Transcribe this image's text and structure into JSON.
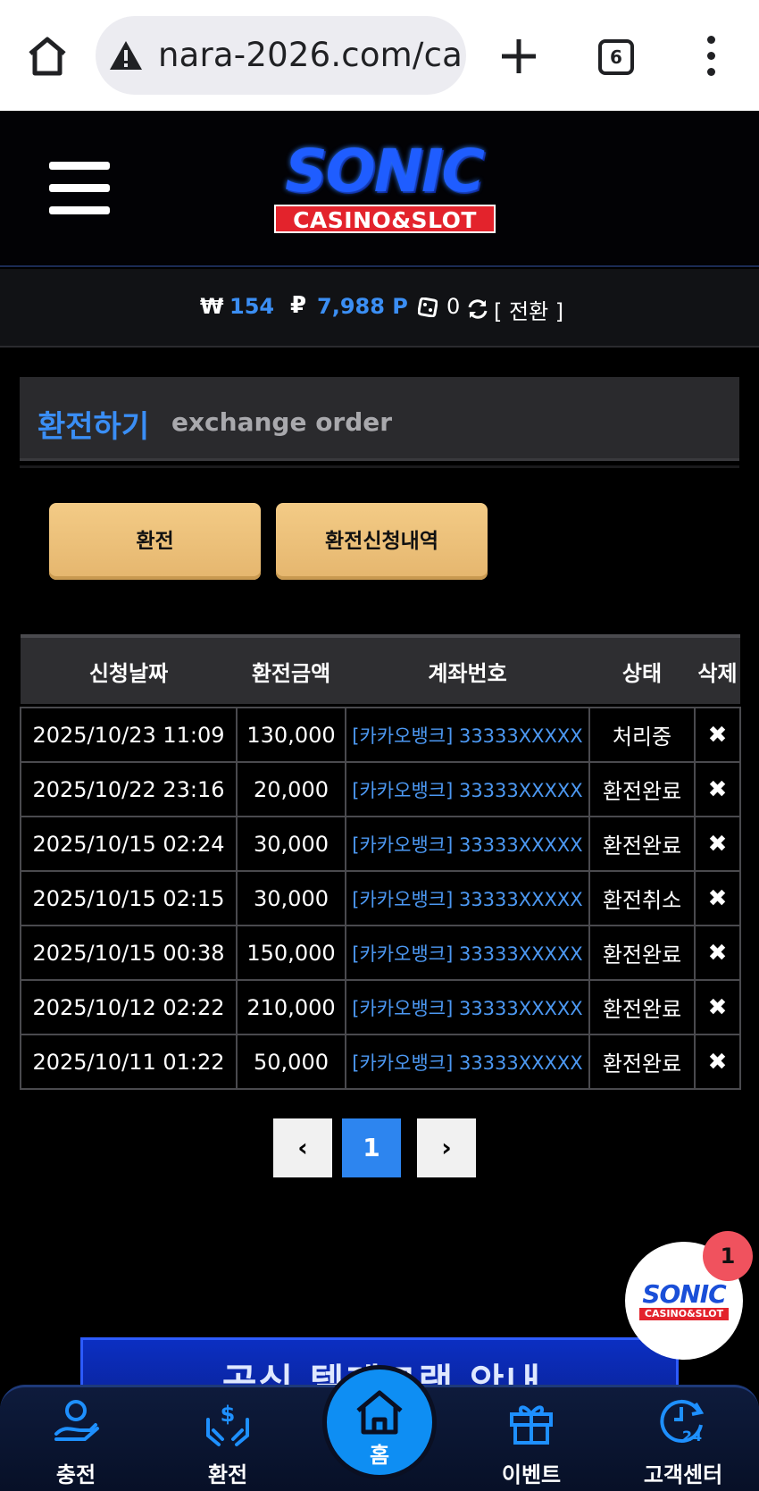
{
  "browser": {
    "url": "nara-2026.com/ca",
    "tab_count": "6"
  },
  "logo": {
    "main": "SONIC",
    "sub": "CASINO&SLOT"
  },
  "balance": {
    "won_symbol": "₩",
    "won_value": "154",
    "point_symbol": "₽",
    "point_value": "7,988 P",
    "chip_value": "0",
    "switch_label": "[ 전환 ]"
  },
  "page": {
    "title_ko": "환전하기",
    "title_en": "exchange order"
  },
  "buttons": {
    "exchange": "환전",
    "history": "환전신청내역"
  },
  "table": {
    "headers": [
      "신청날짜",
      "환전금액",
      "계좌번호",
      "상태",
      "삭제"
    ],
    "rows": [
      {
        "date": "2025/10/23 11:09",
        "amount": "130,000",
        "account": "[카카오뱅크] 33333XXXXX",
        "status": "처리중",
        "delete": "✖"
      },
      {
        "date": "2025/10/22 23:16",
        "amount": "20,000",
        "account": "[카카오뱅크] 33333XXXXX",
        "status": "환전완료",
        "delete": "✖"
      },
      {
        "date": "2025/10/15 02:24",
        "amount": "30,000",
        "account": "[카카오뱅크] 33333XXXXX",
        "status": "환전완료",
        "delete": "✖"
      },
      {
        "date": "2025/10/15 02:15",
        "amount": "30,000",
        "account": "[카카오뱅크] 33333XXXXX",
        "status": "환전취소",
        "delete": "✖"
      },
      {
        "date": "2025/10/15 00:38",
        "amount": "150,000",
        "account": "[카카오뱅크] 33333XXXXX",
        "status": "환전완료",
        "delete": "✖"
      },
      {
        "date": "2025/10/12 02:22",
        "amount": "210,000",
        "account": "[카카오뱅크] 33333XXXXX",
        "status": "환전완료",
        "delete": "✖"
      },
      {
        "date": "2025/10/11 01:22",
        "amount": "50,000",
        "account": "[카카오뱅크] 33333XXXXX",
        "status": "환전완료",
        "delete": "✖"
      }
    ]
  },
  "pagination": {
    "prev": "‹",
    "current": "1",
    "next": "›"
  },
  "floating": {
    "logo_main": "SONIC",
    "logo_sub": "CASINO&SLOT",
    "badge_count": "1"
  },
  "banner": {
    "text": "공식 텔레그램 안내"
  },
  "bottom_nav": {
    "charge": "충전",
    "exchange": "환전",
    "home": "홈",
    "event": "이벤트",
    "support": "고객센터"
  },
  "colors": {
    "accent_blue": "#3b8ef3",
    "gold_button": "#f3cb86",
    "page_active": "#2d85ef",
    "badge_red": "#f0525e"
  },
  "icons": [
    "home-icon",
    "warning-icon",
    "plus-icon",
    "tabs-icon",
    "menu-dots-icon",
    "hamburger-icon",
    "chip-icon",
    "refresh-icon",
    "delete-icon",
    "chevron-left-icon",
    "chevron-right-icon",
    "charge-icon",
    "exchange-icon",
    "home-nav-icon",
    "gift-icon",
    "support-24-icon"
  ]
}
